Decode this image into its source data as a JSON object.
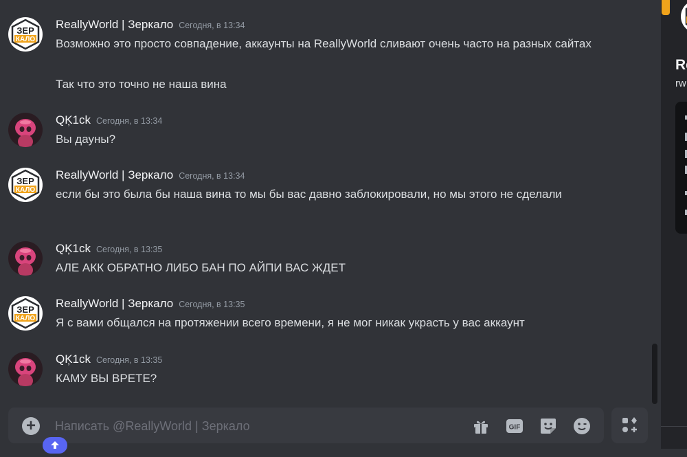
{
  "chat": {
    "messages": [
      {
        "author": "ReallyWorld | Зеркало",
        "timestamp": "Сегодня, в 13:34",
        "avatar": "zerkalo-logo",
        "lines": [
          "Возможно это просто совпадение, аккаунты на ReallyWorld сливают очень часто на разных сайтах",
          "Так что это точно не наша вина"
        ]
      },
      {
        "author": "QĶ1ck",
        "timestamp": "Сегодня, в 13:34",
        "avatar": "character-pink",
        "lines": [
          "Вы дауны?"
        ]
      },
      {
        "author": "ReallyWorld | Зеркало",
        "timestamp": "Сегодня, в 13:34",
        "avatar": "zerkalo-logo",
        "lines": [
          "если бы это была бы наша вина то мы бы вас давно заблокировали, но мы этого не сделали"
        ]
      },
      {
        "author": "QĶ1ck",
        "timestamp": "Сегодня, в 13:35",
        "avatar": "character-pink",
        "lines": [
          "АЛЕ АКК ОБРАТНО ЛИБО БАН ПО АЙПИ ВАС ЖДЕТ"
        ]
      },
      {
        "author": "ReallyWorld | Зеркало",
        "timestamp": "Сегодня, в 13:35",
        "avatar": "zerkalo-logo",
        "lines": [
          "Я с вами общался на протяжении всего времени, я не мог никак украсть у вас аккаунт"
        ]
      },
      {
        "author": "QĶ1ck",
        "timestamp": "Сегодня, в 13:35",
        "avatar": "character-pink",
        "lines": [
          "КАМУ ВЫ ВРЕТЕ?"
        ]
      }
    ],
    "logo": {
      "top": "ЗЕР",
      "bottom": "КАЛО"
    }
  },
  "composer": {
    "placeholder": "Написать @ReallyWorld | Зеркало",
    "gif_label": "GIF",
    "icons": [
      "plus-icon",
      "gift-icon",
      "gif-icon",
      "sticker-icon",
      "emoji-icon",
      "apps-icon"
    ]
  },
  "right_panel": {
    "name": "Re",
    "username": "rw"
  },
  "colors": {
    "background": "#313338",
    "composer": "#383a40",
    "accent": "#5865f2",
    "orange": "#f0a31b"
  }
}
